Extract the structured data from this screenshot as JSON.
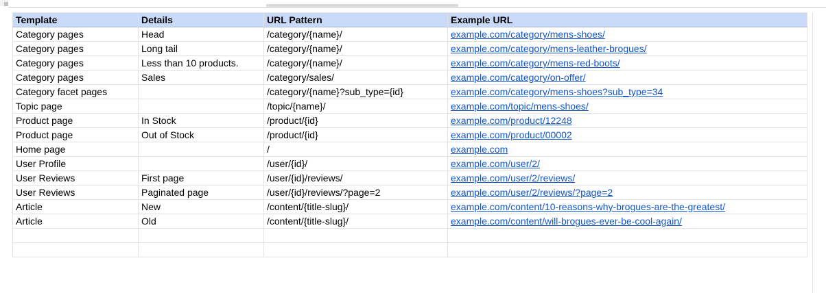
{
  "sheet": {
    "headers": [
      "Template",
      "Details",
      "URL Pattern",
      "Example URL"
    ],
    "rows": [
      [
        "Category pages",
        "Head",
        "/category/{name}/",
        "example.com/category/mens-shoes/"
      ],
      [
        "Category pages",
        "Long tail",
        "/category/{name}/",
        "example.com/category/mens-leather-brogues/"
      ],
      [
        "Category pages",
        "Less than 10 products.",
        "/category/{name}/",
        "example.com/category/mens-red-boots/"
      ],
      [
        "Category pages",
        "Sales",
        "/category/sales/",
        "example.com/category/on-offer/"
      ],
      [
        "Category facet pages",
        "",
        "/category/{name}?sub_type={id}",
        "example.com/category/mens-shoes?sub_type=34"
      ],
      [
        "Topic page",
        "",
        "/topic/{name}/",
        "example.com/topic/mens-shoes/"
      ],
      [
        "Product page",
        "In Stock",
        "/product/{id}",
        "example.com/product/12248"
      ],
      [
        "Product page",
        "Out of Stock",
        "/product/{id}",
        "example.com/product/00002"
      ],
      [
        "Home page",
        "",
        "/",
        "example.com"
      ],
      [
        "User Profile",
        "",
        "/user/{id}/",
        "example.com/user/2/"
      ],
      [
        "User Reviews",
        "First page",
        "/user/{id}/reviews/",
        "example.com/user/2/reviews/"
      ],
      [
        "User Reviews",
        "Paginated page",
        "/user/{id}/reviews/?page=2",
        "example.com/user/2/reviews/?page=2"
      ],
      [
        "Article",
        "New",
        "/content/{title-slug}/",
        "example.com/content/10-reasons-why-brogues-are-the-greatest/"
      ],
      [
        "Article",
        "Old",
        "/content/{title-slug}/",
        "example.com/content/will-brogues-ever-be-cool-again/"
      ]
    ]
  },
  "colors": {
    "header_bg": "#c9daf8",
    "link": "#1155cc",
    "gridline": "#e2e2e2"
  }
}
